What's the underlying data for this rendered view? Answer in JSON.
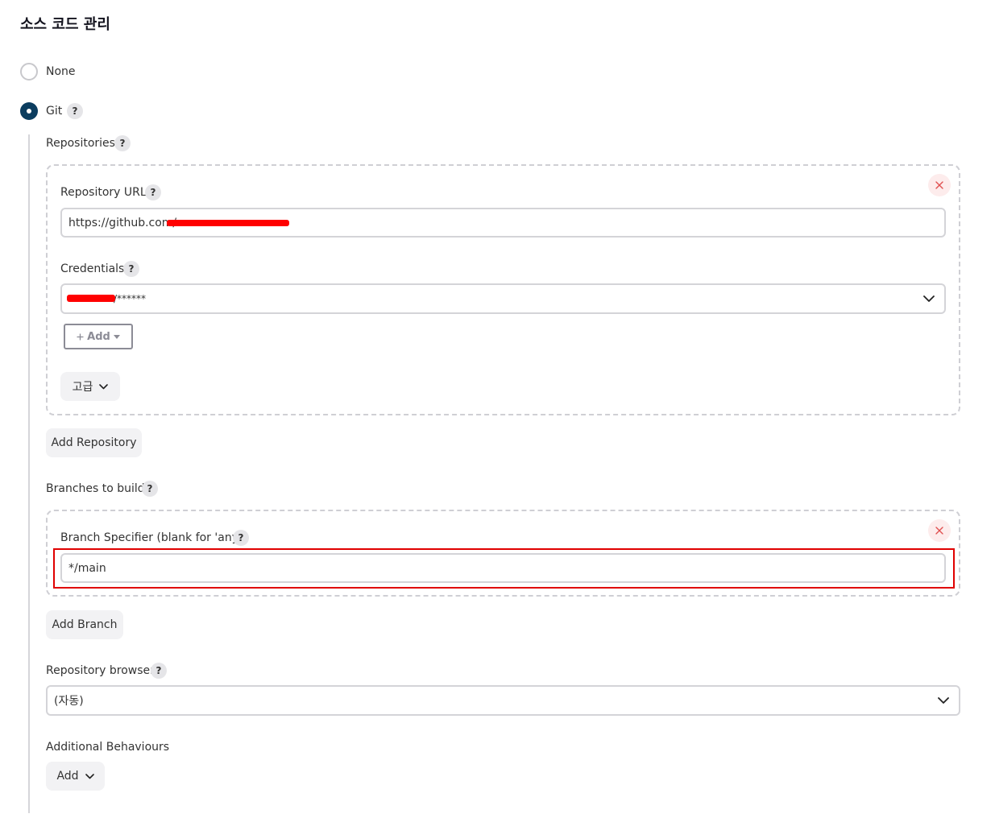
{
  "section": {
    "title": "소스 코드 관리"
  },
  "scm_options": [
    {
      "label": "None",
      "selected": false
    },
    {
      "label": "Git",
      "selected": true,
      "help": "?"
    }
  ],
  "repositories": {
    "label": "Repositories",
    "help": "?",
    "repository_url": {
      "label": "Repository URL",
      "help": "?",
      "value_prefix": "https://github.com/"
    },
    "credentials": {
      "label": "Credentials",
      "help": "?",
      "value_suffix": "/******"
    },
    "add_credentials_label": "Add",
    "advanced_label": "고급",
    "add_repository_label": "Add Repository"
  },
  "branches": {
    "label": "Branches to build",
    "help": "?",
    "branch_specifier": {
      "label": "Branch Specifier (blank for 'any')",
      "help": "?",
      "value": "*/main"
    },
    "add_branch_label": "Add Branch"
  },
  "repository_browser": {
    "label": "Repository browser",
    "help": "?",
    "value": "(자동)"
  },
  "additional_behaviours": {
    "label": "Additional Behaviours",
    "add_label": "Add"
  },
  "colors": {
    "accent": "#0b3d5f",
    "highlight": "#e00000",
    "redaction": "#ff0000",
    "delete_bg": "#fdecec"
  },
  "icons": [
    "help-icon",
    "close-icon",
    "chevron-down-icon",
    "plus-icon",
    "caret-down-icon"
  ]
}
